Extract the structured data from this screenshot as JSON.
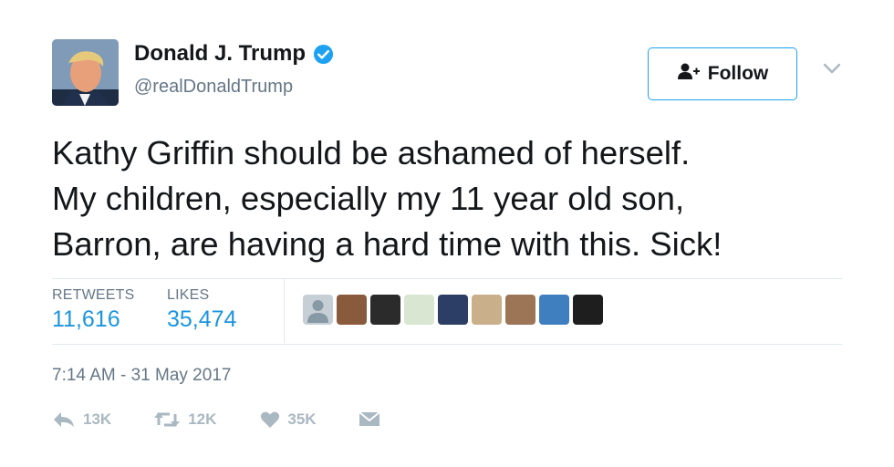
{
  "user": {
    "name": "Donald J. Trump",
    "handle": "@realDonaldTrump",
    "verified": true
  },
  "follow_button": {
    "label": "Follow",
    "icon": "add-user-icon"
  },
  "tweet": {
    "lines": [
      "Kathy Griffin should be ashamed of herself.",
      "My children, especially my 11 year old son,",
      "Barron, are having a hard time with this. Sick!"
    ]
  },
  "stats": {
    "retweets_label": "RETWEETS",
    "retweets_value": "11,616",
    "likes_label": "LIKES",
    "likes_value": "35,474"
  },
  "likers": [
    {
      "icon": "default-avatar",
      "color": "#c7cfd6"
    },
    {
      "icon": "avatar",
      "color": "#8a5a3c"
    },
    {
      "icon": "avatar",
      "color": "#2b2b2b"
    },
    {
      "icon": "avatar",
      "color": "#d9e6d2"
    },
    {
      "icon": "avatar",
      "color": "#2c3e66"
    },
    {
      "icon": "avatar",
      "color": "#c9b08a"
    },
    {
      "icon": "avatar",
      "color": "#9c7456"
    },
    {
      "icon": "avatar",
      "color": "#3f7fbf"
    },
    {
      "icon": "avatar",
      "color": "#1e1e1e"
    }
  ],
  "timestamp": "7:14 AM - 31 May 2017",
  "actions": {
    "reply_count": "13K",
    "retweet_count": "12K",
    "like_count": "35K"
  },
  "colors": {
    "accent": "#1b95e0",
    "muted": "#657786",
    "icon_gray": "#aab8c2",
    "verified_blue": "#1da1f2",
    "border": "#e1e8ed"
  }
}
